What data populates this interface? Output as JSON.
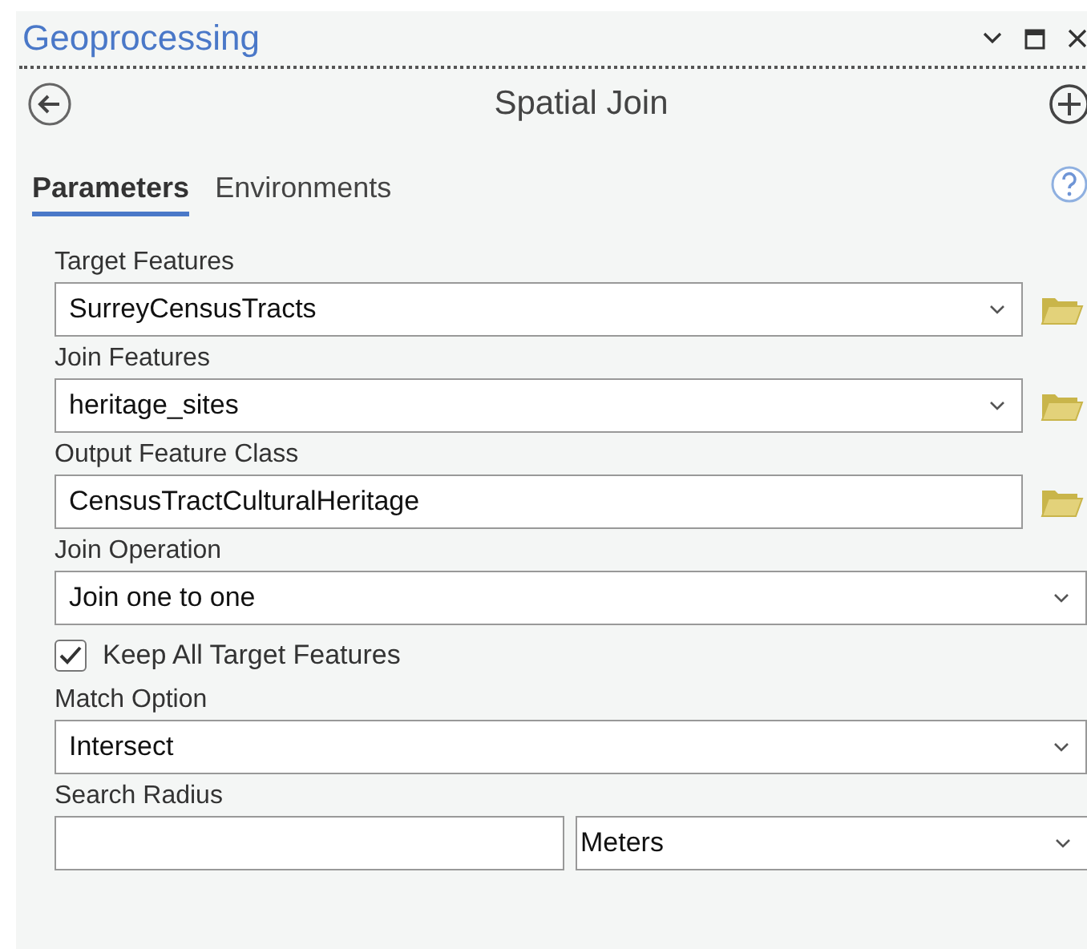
{
  "pane": {
    "title": "Geoprocessing"
  },
  "tool": {
    "title": "Spatial Join"
  },
  "tabs": [
    {
      "label": "Parameters",
      "selected": true
    },
    {
      "label": "Environments",
      "selected": false
    }
  ],
  "parameters": [
    {
      "kind": "dropdown",
      "label": "Target Features",
      "value": "SurreyCensusTracts",
      "browse": true
    },
    {
      "kind": "dropdown",
      "label": "Join Features",
      "value": "heritage_sites",
      "browse": true
    },
    {
      "kind": "text",
      "label": "Output Feature Class",
      "value": "CensusTractCulturalHeritage",
      "browse": true
    },
    {
      "kind": "dropdown",
      "label": "Join Operation",
      "value": "Join one to one",
      "browse": false
    },
    {
      "kind": "checkbox",
      "label": "Keep All Target Features",
      "checked": true
    },
    {
      "kind": "dropdown",
      "label": "Match Option",
      "value": "Intersect",
      "browse": false
    },
    {
      "kind": "distance",
      "label": "Search Radius",
      "unit": "Meters"
    }
  ]
}
